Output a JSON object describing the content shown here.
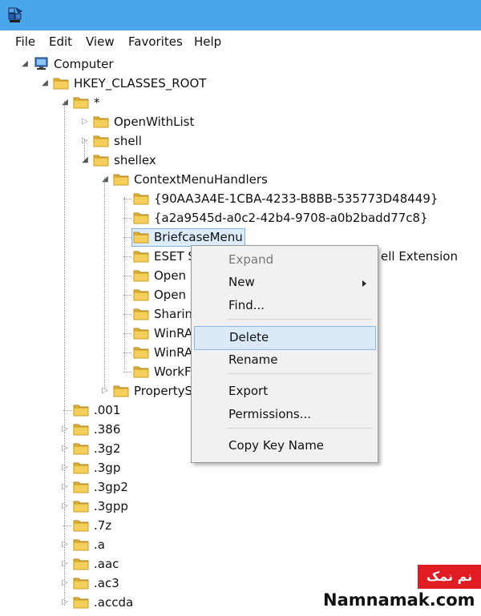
{
  "menubar": [
    "File",
    "Edit",
    "View",
    "Favorites",
    "Help"
  ],
  "tree": [
    {
      "label": "Computer",
      "depth": 0,
      "toggle": "expanded",
      "icon": "computer-icon"
    },
    {
      "label": "HKEY_CLASSES_ROOT",
      "depth": 1,
      "toggle": "expanded",
      "icon": "folder-icon"
    },
    {
      "label": "*",
      "depth": 2,
      "toggle": "expanded",
      "icon": "folder-icon"
    },
    {
      "label": "OpenWithList",
      "depth": 3,
      "toggle": "collapsed",
      "icon": "folder-icon"
    },
    {
      "label": "shell",
      "depth": 3,
      "toggle": "collapsed",
      "icon": "folder-icon"
    },
    {
      "label": "shellex",
      "depth": 3,
      "toggle": "expanded",
      "icon": "folder-icon"
    },
    {
      "label": "ContextMenuHandlers",
      "depth": 4,
      "toggle": "expanded",
      "icon": "folder-icon"
    },
    {
      "label": "{90AA3A4E-1CBA-4233-B8BB-535773D48449}",
      "depth": 5,
      "toggle": "none",
      "icon": "folder-icon"
    },
    {
      "label": "{a2a9545d-a0c2-42b4-9708-a0b2badd77c8}",
      "depth": 5,
      "toggle": "none",
      "icon": "folder-icon"
    },
    {
      "label": "BriefcaseMenu",
      "depth": 5,
      "toggle": "none",
      "icon": "folder-icon",
      "selected": true
    },
    {
      "label": "ESET S",
      "depth": 5,
      "toggle": "none",
      "icon": "folder-icon",
      "trail": "ell Extension"
    },
    {
      "label": "Open",
      "depth": 5,
      "toggle": "none",
      "icon": "folder-icon"
    },
    {
      "label": "Open",
      "depth": 5,
      "toggle": "none",
      "icon": "folder-icon"
    },
    {
      "label": "Sharin",
      "depth": 5,
      "toggle": "none",
      "icon": "folder-icon"
    },
    {
      "label": "WinRA",
      "depth": 5,
      "toggle": "none",
      "icon": "folder-icon"
    },
    {
      "label": "WinRA",
      "depth": 5,
      "toggle": "none",
      "icon": "folder-icon"
    },
    {
      "label": "WorkF",
      "depth": 5,
      "toggle": "none",
      "icon": "folder-icon"
    },
    {
      "label": "PropertyS",
      "depth": 4,
      "toggle": "collapsed",
      "icon": "folder-icon"
    },
    {
      "label": ".001",
      "depth": 2,
      "toggle": "none",
      "icon": "folder-icon"
    },
    {
      "label": ".386",
      "depth": 2,
      "toggle": "collapsed",
      "icon": "folder-icon"
    },
    {
      "label": ".3g2",
      "depth": 2,
      "toggle": "collapsed",
      "icon": "folder-icon"
    },
    {
      "label": ".3gp",
      "depth": 2,
      "toggle": "collapsed",
      "icon": "folder-icon"
    },
    {
      "label": ".3gp2",
      "depth": 2,
      "toggle": "collapsed",
      "icon": "folder-icon"
    },
    {
      "label": ".3gpp",
      "depth": 2,
      "toggle": "collapsed",
      "icon": "folder-icon"
    },
    {
      "label": ".7z",
      "depth": 2,
      "toggle": "none",
      "icon": "folder-icon"
    },
    {
      "label": ".a",
      "depth": 2,
      "toggle": "collapsed",
      "icon": "folder-icon"
    },
    {
      "label": ".aac",
      "depth": 2,
      "toggle": "collapsed",
      "icon": "folder-icon"
    },
    {
      "label": ".ac3",
      "depth": 2,
      "toggle": "collapsed",
      "icon": "folder-icon"
    },
    {
      "label": ".accda",
      "depth": 2,
      "toggle": "collapsed",
      "icon": "folder-icon"
    }
  ],
  "context_menu": {
    "items": [
      {
        "label": "Expand",
        "type": "item",
        "state": "disabled"
      },
      {
        "label": "New",
        "type": "item",
        "submenu": true
      },
      {
        "label": "Find...",
        "type": "item"
      },
      {
        "type": "separator"
      },
      {
        "label": "Delete",
        "type": "item",
        "state": "highlighted"
      },
      {
        "label": "Rename",
        "type": "item"
      },
      {
        "type": "separator"
      },
      {
        "label": "Export",
        "type": "item"
      },
      {
        "label": "Permissions...",
        "type": "item"
      },
      {
        "type": "separator"
      },
      {
        "label": "Copy Key Name",
        "type": "item"
      }
    ]
  },
  "watermark": {
    "badge": "نم نمک",
    "site": "Namnamak.com"
  },
  "colors": {
    "titlebar": "#4aa6ea",
    "selection": "#dcecfb",
    "menu_highlight": "#dceaf8",
    "folder": "#f1c649"
  }
}
